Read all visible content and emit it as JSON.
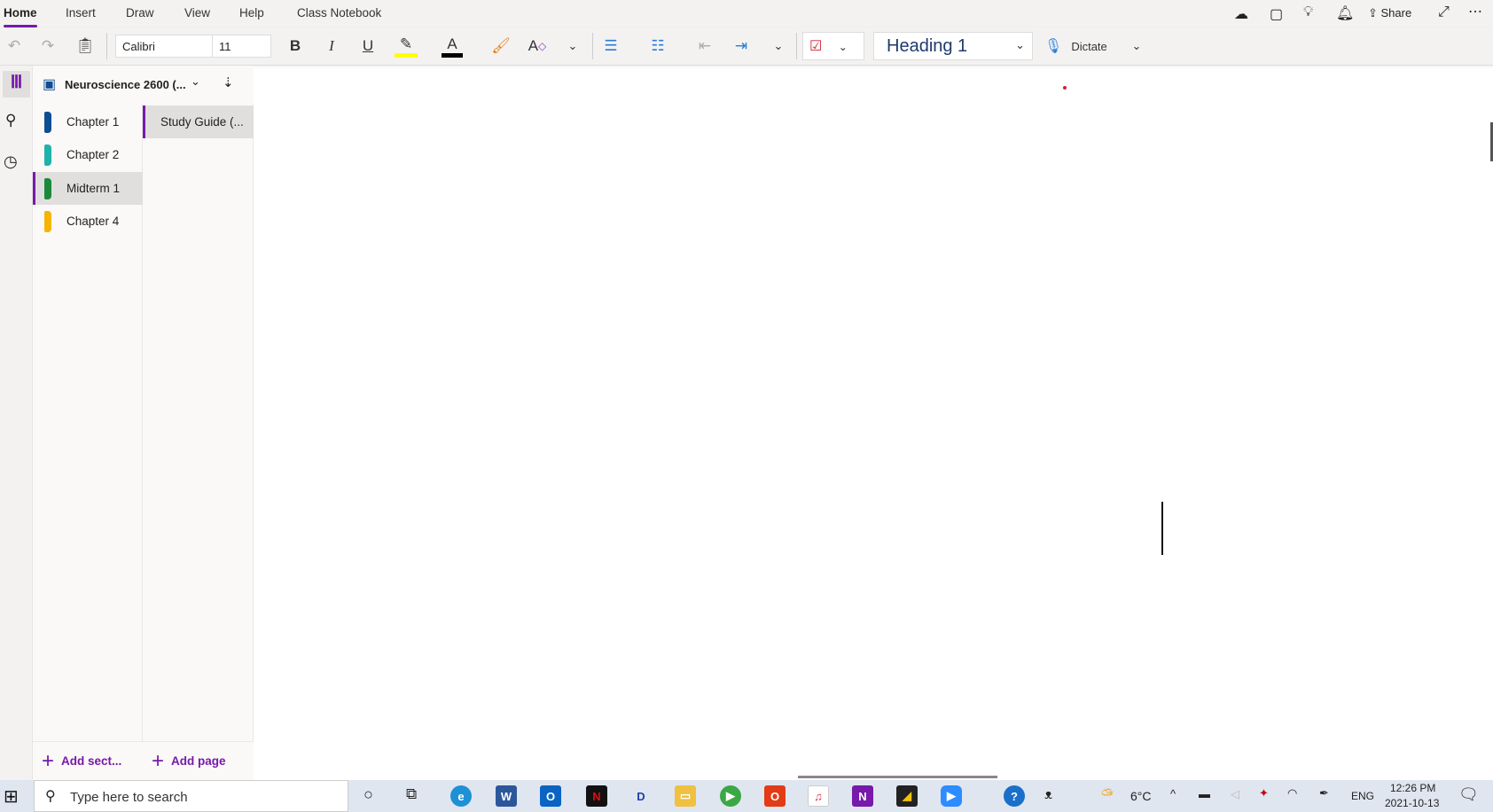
{
  "menu": {
    "tabs": [
      "Home",
      "Insert",
      "Draw",
      "View",
      "Help",
      "Class Notebook"
    ],
    "share": "Share"
  },
  "toolbar": {
    "font": "Calibri",
    "size": "11",
    "style": "Heading 1",
    "dictate": "Dictate",
    "highlight_color": "#ffff00",
    "font_color": "#000000"
  },
  "notebook": {
    "name": "Neuroscience 2600 (..."
  },
  "sections": [
    {
      "label": "Chapter 1",
      "color": "#0f4d92"
    },
    {
      "label": "Chapter 2",
      "color": "#20b2aa"
    },
    {
      "label": "Midterm 1",
      "color": "#1a8a3a"
    },
    {
      "label": "Chapter 4",
      "color": "#f5b400"
    }
  ],
  "pages": [
    {
      "label": "Study Guide (..."
    }
  ],
  "add_section": "Add sect...",
  "add_page": "Add page",
  "taskbar": {
    "search_placeholder": "Type here to search",
    "weather": "6°C",
    "lang": "ENG",
    "time": "12:26 PM",
    "date": "2021-10-13"
  },
  "accent": "#7719aa"
}
